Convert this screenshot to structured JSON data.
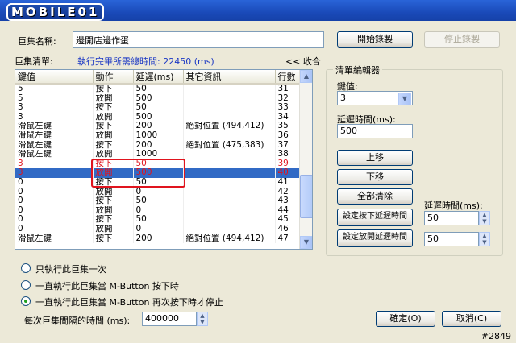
{
  "window": {
    "title": "MOBILE01"
  },
  "macro_name": {
    "label": "巨集名稱:",
    "value": "邊開店邊作蛋"
  },
  "buttons": {
    "start_record": "開始錄製",
    "stop_record": "停止錄製",
    "ok": "確定(O)",
    "cancel": "取消(C)"
  },
  "list_header": {
    "label": "巨集清單:",
    "total_time": "執行完畢所需總時間: 22450 (ms)",
    "collapse": "<< 收合"
  },
  "table": {
    "columns": [
      "鍵值",
      "動作",
      "延遲(ms)",
      "其它資訊",
      "行數"
    ],
    "rows": [
      [
        "5",
        "按下",
        "50",
        "",
        "31"
      ],
      [
        "5",
        "放開",
        "500",
        "",
        "32"
      ],
      [
        "3",
        "按下",
        "50",
        "",
        "33"
      ],
      [
        "3",
        "放開",
        "500",
        "",
        "34"
      ],
      [
        "滑鼠左鍵",
        "按下",
        "200",
        "絕對位置 (494,412)",
        "35"
      ],
      [
        "滑鼠左鍵",
        "放開",
        "1000",
        "",
        "36"
      ],
      [
        "滑鼠左鍵",
        "按下",
        "200",
        "絕對位置 (475,383)",
        "37"
      ],
      [
        "滑鼠左鍵",
        "放開",
        "1000",
        "",
        "38"
      ],
      [
        "3",
        "按下",
        "50",
        "",
        "39"
      ],
      [
        "3",
        "放開",
        "500",
        "",
        "40"
      ],
      [
        "0",
        "按下",
        "50",
        "",
        "41"
      ],
      [
        "0",
        "放開",
        "0",
        "",
        "42"
      ],
      [
        "0",
        "按下",
        "50",
        "",
        "43"
      ],
      [
        "0",
        "放開",
        "0",
        "",
        "44"
      ],
      [
        "0",
        "按下",
        "50",
        "",
        "45"
      ],
      [
        "0",
        "放開",
        "0",
        "",
        "46"
      ],
      [
        "滑鼠左鍵",
        "按下",
        "200",
        "絕對位置 (494,412)",
        "47"
      ]
    ]
  },
  "editor": {
    "group_title": "清單編輯器",
    "key_label": "鍵值:",
    "key_value": "3",
    "delay_label": "延遲時間(ms):",
    "delay_value": "500",
    "move_up": "上移",
    "move_down": "下移",
    "clear_all": "全部清除",
    "set_press_delay": "設定按下延遲時間",
    "set_release_delay": "設定放開延遲時間",
    "side_delay_label": "延遲時間(ms):",
    "press_delay_value": "50",
    "release_delay_value": "50"
  },
  "run_options": {
    "once": "只執行此巨集一次",
    "while_pressed": "一直執行此巨集當 M-Button 按下時",
    "until_pressed_again": "一直執行此巨集當 M-Button 再次按下時才停止",
    "selected": "until_pressed_again"
  },
  "interval": {
    "label": "每次巨集間隔的時間 (ms):",
    "value": "400000"
  },
  "watermark": "#2849",
  "colors": {
    "selection": "#316ac5",
    "highlight_red": "#e0141e",
    "title_blue": "#1a4ab9"
  }
}
